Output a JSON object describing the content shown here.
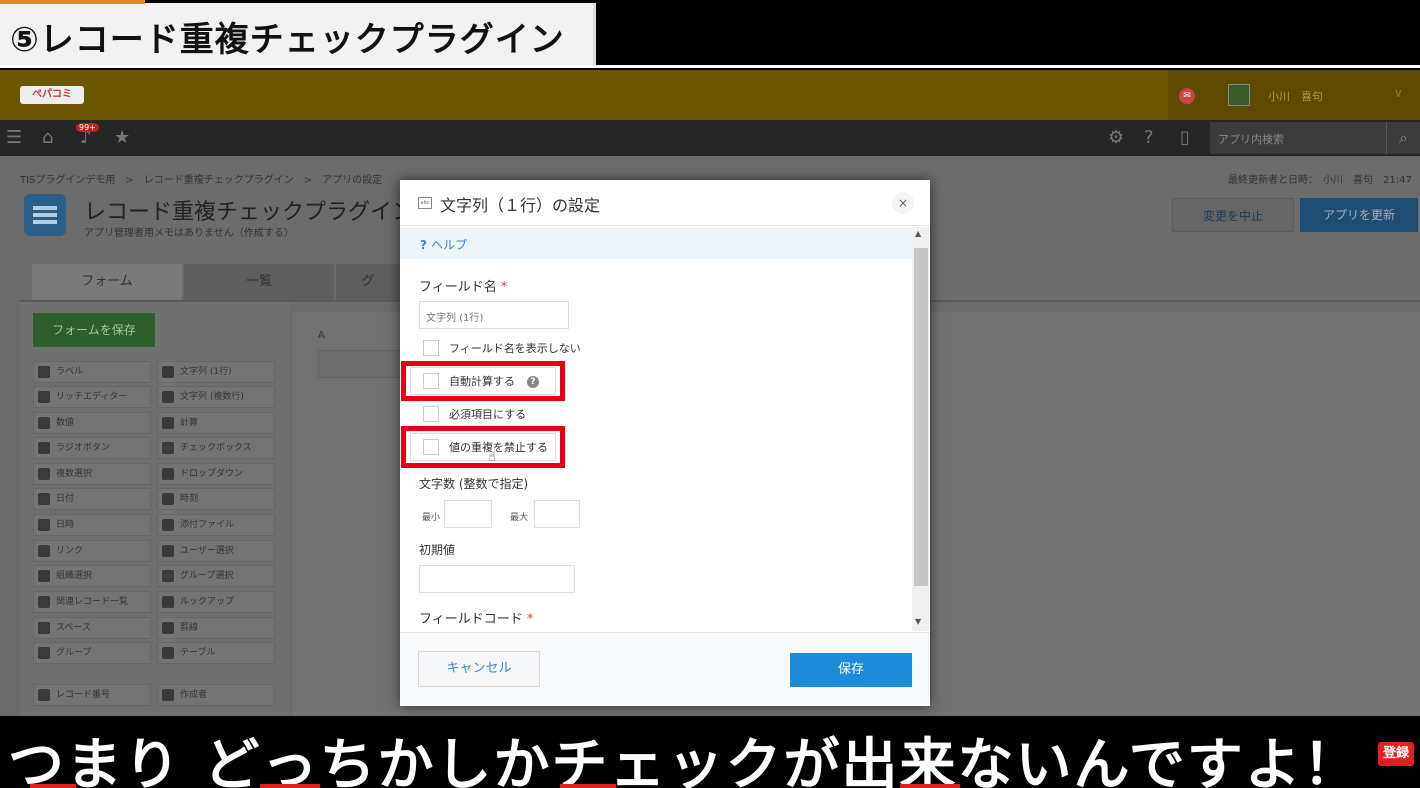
{
  "banner": {
    "title": "⑤レコード重複チェックプラグイン"
  },
  "header": {
    "logo_text": "ぺパコミ",
    "user_name": "小川　喜句",
    "notification_badge": "99+",
    "search_placeholder": "アプリ内検索"
  },
  "page": {
    "breadcrumb": "TISプラグインデモ用　>　レコード重複チェックプラグイン　>　アプリの設定",
    "updated_label": "最終更新者と日時：　小川　喜句　21:47",
    "app_title": "レコード重複チェックプラグイン",
    "app_memo": "アプリ管理者用メモはありません（作成する）",
    "cancel_change_label": "変更を中止",
    "update_app_label": "アプリを更新",
    "tabs": [
      {
        "label": "フォーム"
      },
      {
        "label": "一覧"
      },
      {
        "label": "グ"
      }
    ],
    "save_form_label": "フォームを保存",
    "canvas_label": "A"
  },
  "palette": [
    {
      "label": "ラベル"
    },
    {
      "label": "文字列 (1行)"
    },
    {
      "label": "リッチエディター"
    },
    {
      "label": "文字列 (複数行)"
    },
    {
      "label": "数値"
    },
    {
      "label": "計算"
    },
    {
      "label": "ラジオボタン"
    },
    {
      "label": "チェックボックス"
    },
    {
      "label": "複数選択"
    },
    {
      "label": "ドロップダウン"
    },
    {
      "label": "日付"
    },
    {
      "label": "時刻"
    },
    {
      "label": "日時"
    },
    {
      "label": "添付ファイル"
    },
    {
      "label": "リンク"
    },
    {
      "label": "ユーザー選択"
    },
    {
      "label": "組織選択"
    },
    {
      "label": "グループ選択"
    },
    {
      "label": "関連レコード一覧"
    },
    {
      "label": "ルックアップ"
    },
    {
      "label": "スペース"
    },
    {
      "label": "罫線"
    },
    {
      "label": "グループ"
    },
    {
      "label": "テーブル"
    },
    {
      "label": "レコード番号"
    },
    {
      "label": "作成者"
    }
  ],
  "modal": {
    "title": "文字列（１行）の設定",
    "help": "ヘルプ",
    "field_name_label": "フィールド名",
    "required_mark": "*",
    "field_name_value": "文字列 (1行)",
    "checkbox_hide_name": "フィールド名を表示しない",
    "checkbox_auto_calc": "自動計算する",
    "checkbox_required": "必須項目にする",
    "checkbox_unique": "値の重複を禁止する",
    "length_label": "文字数 (整数で指定)",
    "min_label": "最小",
    "max_label": "最大",
    "default_label": "初期値",
    "field_code_label": "フィールドコード",
    "cancel_label": "キャンセル",
    "save_label": "保存"
  },
  "subtitle": {
    "text": "つまり どっちかしかチェックが出来ないんですよ！",
    "badge": "登録"
  },
  "colors": {
    "header": "#6a5700",
    "highlight": "#e60012",
    "primary": "#1e8ad8"
  }
}
